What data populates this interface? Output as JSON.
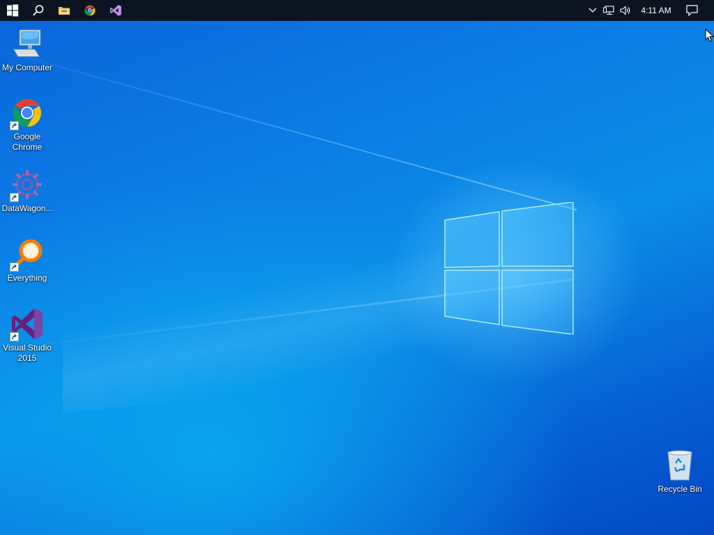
{
  "taskbar": {
    "pinned": [
      {
        "name": "start-button",
        "icon": "windows-logo-icon"
      },
      {
        "name": "search-button",
        "icon": "search-icon"
      },
      {
        "name": "file-explorer",
        "icon": "folder-icon"
      },
      {
        "name": "google-chrome",
        "icon": "chrome-icon"
      },
      {
        "name": "visual-studio",
        "icon": "visual-studio-icon"
      }
    ],
    "tray": {
      "clock": "4:11 AM"
    },
    "background": "#0b1420"
  },
  "desktop": {
    "icons": [
      {
        "label": "My Computer",
        "icon": "computer-icon"
      },
      {
        "label": "Google Chrome",
        "icon": "chrome-icon"
      },
      {
        "label": "DataWagon...",
        "icon": "datawagon-icon"
      },
      {
        "label": "Everything",
        "icon": "everything-search-icon"
      },
      {
        "label": "Visual Studio 2015",
        "icon": "visual-studio-icon"
      },
      {
        "label": "Recycle Bin",
        "icon": "recycle-bin-icon"
      }
    ]
  },
  "colors": {
    "accent": "#0a78e0",
    "vs_purple": "#68217a"
  }
}
